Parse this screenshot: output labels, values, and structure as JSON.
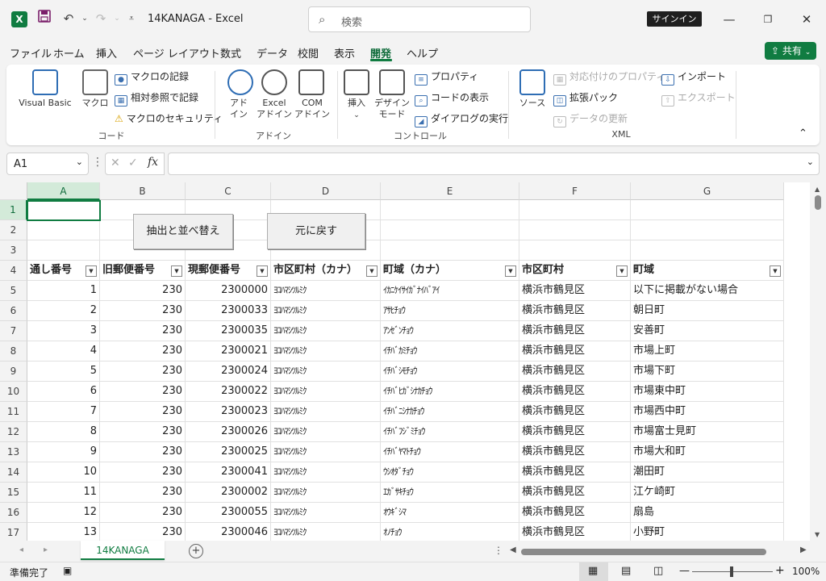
{
  "app": {
    "title": "14KANAGA  -  Excel",
    "signin": "サインイン"
  },
  "search": {
    "placeholder": "検索"
  },
  "tabs": [
    {
      "label": "ファイル"
    },
    {
      "label": "ホーム"
    },
    {
      "label": "挿入"
    },
    {
      "label": "ページ レイアウト"
    },
    {
      "label": "数式"
    },
    {
      "label": "データ"
    },
    {
      "label": "校閲"
    },
    {
      "label": "表示"
    },
    {
      "label": "開発"
    },
    {
      "label": "ヘルプ"
    }
  ],
  "share_label": "共有",
  "ribbon": {
    "code": {
      "group": "コード",
      "visual_basic": "Visual Basic",
      "macro": "マクロ",
      "record_macro": "マクロの記録",
      "relative_ref": "相対参照で記録",
      "macro_security": "マクロのセキュリティ"
    },
    "addins": {
      "group": "アドイン",
      "addin": "アド\nイン",
      "excel_addin": "Excel\nアドイン",
      "com_addin": "COM\nアドイン"
    },
    "controls": {
      "group": "コントロール",
      "insert": "挿入",
      "design_mode": "デザイン\nモード",
      "properties": "プロパティ",
      "view_code": "コードの表示",
      "run_dialog": "ダイアログの実行"
    },
    "xml": {
      "group": "XML",
      "source": "ソース",
      "map_properties": "対応付けのプロパティ",
      "expansion_packs": "拡張パック",
      "refresh_data": "データの更新",
      "import": "インポート",
      "export": "エクスポート"
    }
  },
  "namebox": "A1",
  "columns": [
    "A",
    "B",
    "C",
    "D",
    "E",
    "F",
    "G"
  ],
  "buttons": {
    "extract_sort": "抽出と並べ替え",
    "restore": "元に戻す"
  },
  "table": {
    "headers": [
      "通し番号",
      "旧郵便番号",
      "現郵便番号",
      "市区町村（カナ）",
      "町域（カナ）",
      "市区町村",
      "町域"
    ],
    "rows": [
      [
        "1",
        "230",
        "2300000",
        "ﾖｺﾊﾏｼﾂﾙﾐｸ",
        "ｲｶﾆｹｲｻｲｶﾞﾅｲﾊﾞｱｲ",
        "横浜市鶴見区",
        "以下に掲載がない場合"
      ],
      [
        "2",
        "230",
        "2300033",
        "ﾖｺﾊﾏｼﾂﾙﾐｸ",
        "ｱｻﾋﾁｮｳ",
        "横浜市鶴見区",
        "朝日町"
      ],
      [
        "3",
        "230",
        "2300035",
        "ﾖｺﾊﾏｼﾂﾙﾐｸ",
        "ｱﾝｾﾞﾝﾁｮｳ",
        "横浜市鶴見区",
        "安善町"
      ],
      [
        "4",
        "230",
        "2300021",
        "ﾖｺﾊﾏｼﾂﾙﾐｸ",
        "ｲﾁﾊﾞｶﾐﾁｮｳ",
        "横浜市鶴見区",
        "市場上町"
      ],
      [
        "5",
        "230",
        "2300024",
        "ﾖｺﾊﾏｼﾂﾙﾐｸ",
        "ｲﾁﾊﾞｼﾓﾁｮｳ",
        "横浜市鶴見区",
        "市場下町"
      ],
      [
        "6",
        "230",
        "2300022",
        "ﾖｺﾊﾏｼﾂﾙﾐｸ",
        "ｲﾁﾊﾞﾋｶﾞｼﾅｶﾁｮｳ",
        "横浜市鶴見区",
        "市場東中町"
      ],
      [
        "7",
        "230",
        "2300023",
        "ﾖｺﾊﾏｼﾂﾙﾐｸ",
        "ｲﾁﾊﾞﾆｼﾅｶﾁｮｳ",
        "横浜市鶴見区",
        "市場西中町"
      ],
      [
        "8",
        "230",
        "2300026",
        "ﾖｺﾊﾏｼﾂﾙﾐｸ",
        "ｲﾁﾊﾞﾌｼﾞﾐﾁｮｳ",
        "横浜市鶴見区",
        "市場富士見町"
      ],
      [
        "9",
        "230",
        "2300025",
        "ﾖｺﾊﾏｼﾂﾙﾐｸ",
        "ｲﾁﾊﾞﾔﾏﾄﾁｮｳ",
        "横浜市鶴見区",
        "市場大和町"
      ],
      [
        "10",
        "230",
        "2300041",
        "ﾖｺﾊﾏｼﾂﾙﾐｸ",
        "ｳｼｵﾀﾞﾁｮｳ",
        "横浜市鶴見区",
        "潮田町"
      ],
      [
        "11",
        "230",
        "2300002",
        "ﾖｺﾊﾏｼﾂﾙﾐｸ",
        "ｴｶﾞｻｷﾁｮｳ",
        "横浜市鶴見区",
        "江ケ崎町"
      ],
      [
        "12",
        "230",
        "2300055",
        "ﾖｺﾊﾏｼﾂﾙﾐｸ",
        "ｵｳｷﾞｼﾏ",
        "横浜市鶴見区",
        "扇島"
      ],
      [
        "13",
        "230",
        "2300046",
        "ﾖｺﾊﾏｼﾂﾙﾐｸ",
        "ｵﾉﾁｮｳ",
        "横浜市鶴見区",
        "小野町"
      ]
    ]
  },
  "sheet_tab": "14KANAGA",
  "status": {
    "ready": "準備完了",
    "zoom": "100%"
  },
  "colors": {
    "accent": "#107c41"
  }
}
